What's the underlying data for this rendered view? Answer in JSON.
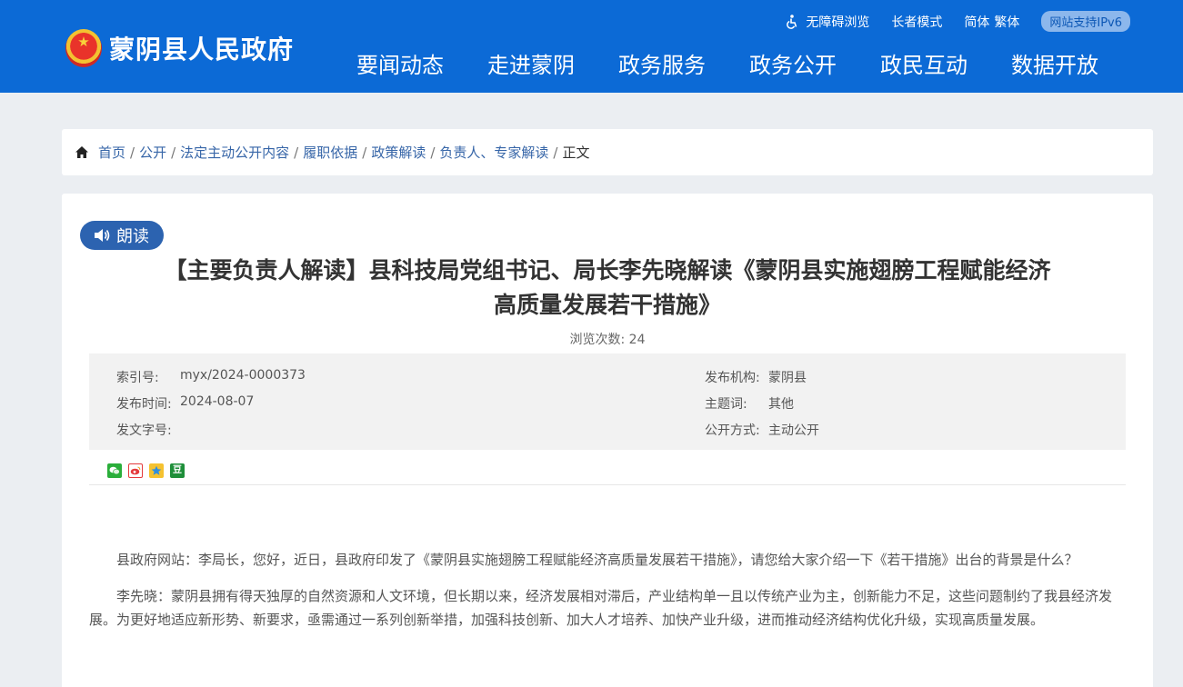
{
  "site": {
    "name": "蒙阴县人民政府"
  },
  "topbar": {
    "accessible": "无障碍浏览",
    "elder": "长者模式",
    "simplified": "简体",
    "traditional": "繁体",
    "ipv6": "网站支持IPv6"
  },
  "nav": [
    {
      "label": "要闻动态"
    },
    {
      "label": "走进蒙阴"
    },
    {
      "label": "政务服务"
    },
    {
      "label": "政务公开"
    },
    {
      "label": "政民互动"
    },
    {
      "label": "数据开放"
    }
  ],
  "breadcrumb": {
    "items": [
      "首页",
      "公开",
      "法定主动公开内容",
      "履职依据",
      "政策解读",
      "负责人、专家解读"
    ],
    "current": "正文"
  },
  "article": {
    "read_label": "朗读",
    "title_line1": "【主要负责人解读】县科技局党组书记、局长李先晓解读《蒙阴县实施翅膀工程赋能经济",
    "title_line2": "高质量发展若干措施》",
    "views_label": "浏览次数:",
    "views_count": "24",
    "meta": {
      "index_label": "索引号:",
      "index_value": "myx/2024-0000373",
      "date_label": "发布时间:",
      "date_value": "2024-08-07",
      "docno_label": "发文字号:",
      "docno_value": "",
      "org_label": "发布机构:",
      "org_value": "蒙阴县",
      "topic_label": "主题词:",
      "topic_value": "其他",
      "mode_label": "公开方式:",
      "mode_value": "主动公开"
    },
    "share": [
      "微信",
      "微博",
      "QQ空间",
      "豆"
    ],
    "paragraphs": [
      "县政府网站：李局长，您好，近日，县政府印发了《蒙阴县实施翅膀工程赋能经济高质量发展若干措施》，请您给大家介绍一下《若干措施》出台的背景是什么？",
      "李先晓：蒙阴县拥有得天独厚的自然资源和人文环境，但长期以来，经济发展相对滞后，产业结构单一且以传统产业为主，创新能力不足，这些问题制约了我县经济发展。为更好地适应新形势、新要求，亟需通过一系列创新举措，加强科技创新、加大人才培养、加快产业升级，进而推动经济结构优化升级，实现高质量发展。"
    ]
  },
  "colors": {
    "header_bg": "#0c6ad6",
    "read_button": "#2c63b0",
    "link": "#3766a8"
  }
}
